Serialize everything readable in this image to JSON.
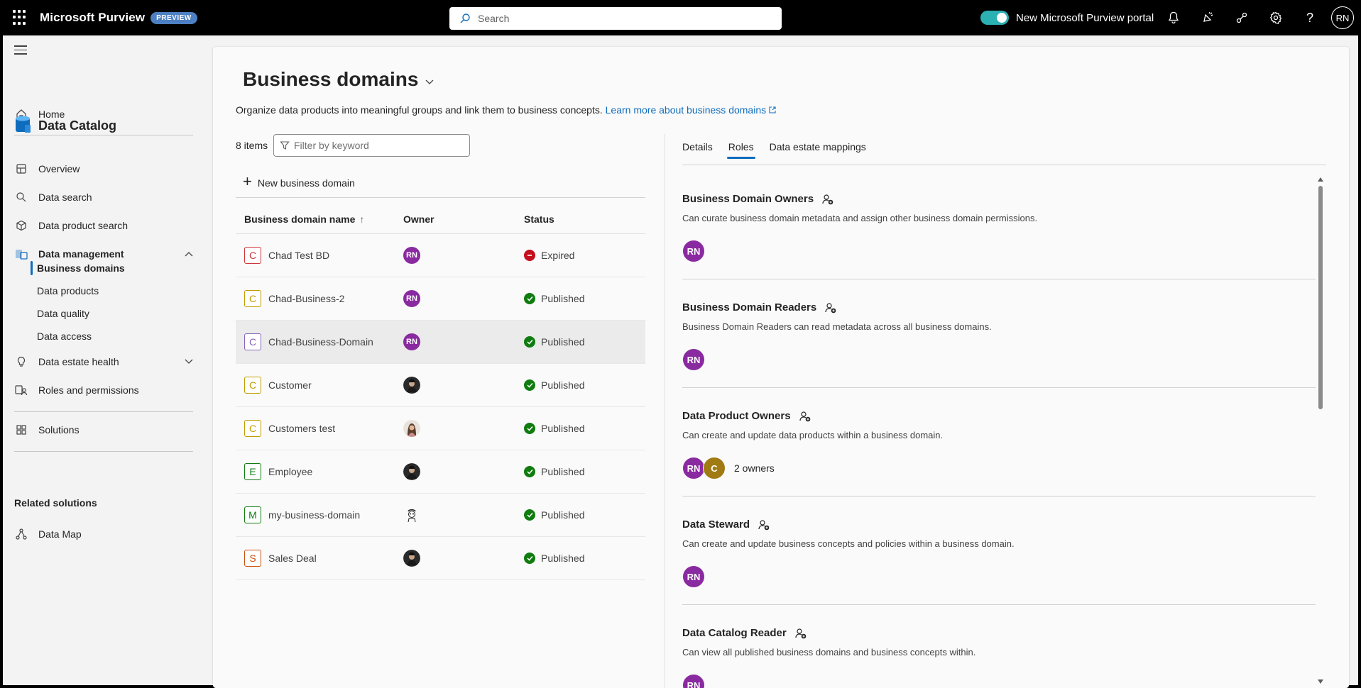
{
  "topbar": {
    "brand": "Microsoft Purview",
    "badge": "PREVIEW",
    "search_placeholder": "Search",
    "toggle_label": "New Microsoft Purview portal",
    "user_initials": "RN"
  },
  "nav": {
    "home": "Home",
    "section_title": "Data Catalog",
    "overview": "Overview",
    "data_search": "Data search",
    "data_product_search": "Data product search",
    "data_management": "Data management",
    "sub": {
      "business_domains": "Business domains",
      "data_products": "Data products",
      "data_quality": "Data quality",
      "data_access": "Data access"
    },
    "data_estate_health": "Data estate health",
    "roles_permissions": "Roles and permissions",
    "solutions": "Solutions",
    "related_heading": "Related solutions",
    "data_map": "Data Map"
  },
  "page": {
    "title": "Business domains",
    "subtitle": "Organize data products into meaningful groups and link them to business concepts.",
    "learn_more": "Learn more about business domains",
    "item_count": "8 items",
    "filter_placeholder": "Filter by keyword",
    "new_button": "New business domain"
  },
  "table": {
    "headers": [
      "Business domain name",
      "Owner",
      "Status"
    ],
    "rows": [
      {
        "letter": "C",
        "letter_color": "#d13438",
        "name": "Chad Test BD",
        "owner": "RN",
        "owner_type": "initials",
        "status": "Expired",
        "status_color": "#c50f1f"
      },
      {
        "letter": "C",
        "letter_color": "#c19c00",
        "name": "Chad-Business-2",
        "owner": "RN",
        "owner_type": "initials",
        "status": "Published",
        "status_color": "#107c10"
      },
      {
        "letter": "C",
        "letter_color": "#8764b8",
        "name": "Chad-Business-Domain",
        "owner": "RN",
        "owner_type": "initials",
        "status": "Published",
        "status_color": "#107c10"
      },
      {
        "letter": "C",
        "letter_color": "#c19c00",
        "name": "Customer",
        "owner": "",
        "owner_type": "photo-dark",
        "status": "Published",
        "status_color": "#107c10"
      },
      {
        "letter": "C",
        "letter_color": "#c19c00",
        "name": "Customers test",
        "owner": "",
        "owner_type": "photo-light",
        "status": "Published",
        "status_color": "#107c10"
      },
      {
        "letter": "E",
        "letter_color": "#107c10",
        "name": "Employee",
        "owner": "",
        "owner_type": "photo-dark",
        "status": "Published",
        "status_color": "#107c10"
      },
      {
        "letter": "M",
        "letter_color": "#107c10",
        "name": "my-business-domain",
        "owner": "",
        "owner_type": "photo-sketch",
        "status": "Published",
        "status_color": "#107c10"
      },
      {
        "letter": "S",
        "letter_color": "#ca5010",
        "name": "Sales Deal",
        "owner": "",
        "owner_type": "photo-dark",
        "status": "Published",
        "status_color": "#107c10"
      }
    ]
  },
  "tabs": [
    "Details",
    "Roles",
    "Data estate mappings"
  ],
  "roles": [
    {
      "title": "Business Domain Owners",
      "desc": "Can curate business domain metadata and assign other business domain permissions.",
      "people": [
        "RN"
      ],
      "count_label": ""
    },
    {
      "title": "Business Domain Readers",
      "desc": "Business Domain Readers can read metadata across all business domains.",
      "people": [
        "RN"
      ],
      "count_label": ""
    },
    {
      "title": "Data Product Owners",
      "desc": "Can create and update data products within a business domain.",
      "people": [
        "RN",
        "C"
      ],
      "count_label": "2 owners"
    },
    {
      "title": "Data Steward",
      "desc": "Can create and update business concepts and policies within a business domain.",
      "people": [
        "RN"
      ],
      "count_label": ""
    },
    {
      "title": "Data Catalog Reader",
      "desc": "Can view all published business domains and business concepts within.",
      "people": [
        "RN"
      ],
      "count_label": ""
    }
  ]
}
